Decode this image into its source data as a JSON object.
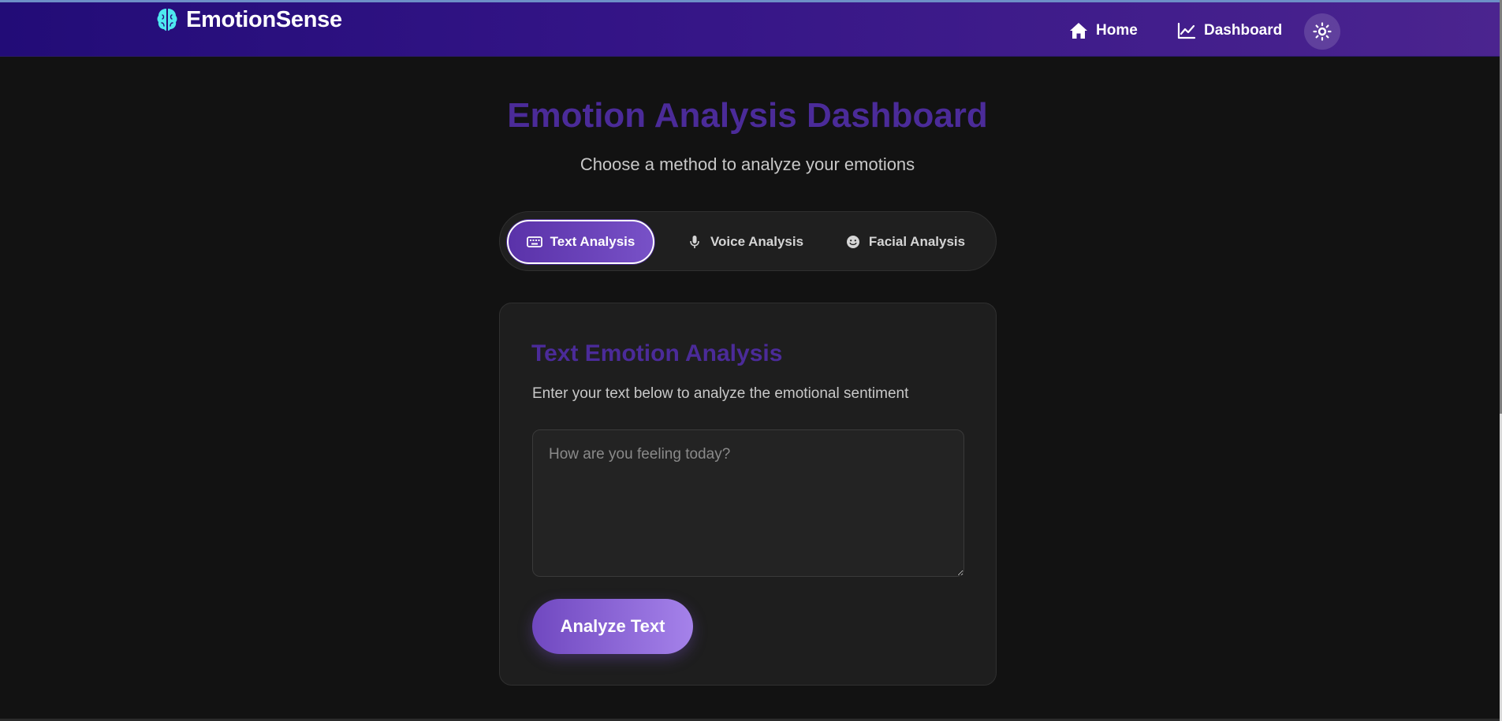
{
  "brand": {
    "name": "EmotionSense",
    "icon": "brain-icon"
  },
  "nav": {
    "items": [
      {
        "label": "Home",
        "icon": "home-icon"
      },
      {
        "label": "Dashboard",
        "icon": "chart-line-icon"
      }
    ],
    "theme_toggle_icon": "sun-icon"
  },
  "page": {
    "title": "Emotion Analysis Dashboard",
    "subtitle": "Choose a method to analyze your emotions"
  },
  "tabs": [
    {
      "label": "Text Analysis",
      "icon": "keyboard-icon",
      "active": true
    },
    {
      "label": "Voice Analysis",
      "icon": "microphone-icon",
      "active": false
    },
    {
      "label": "Facial Analysis",
      "icon": "smile-icon",
      "active": false
    }
  ],
  "card": {
    "title": "Text Emotion Analysis",
    "description": "Enter your text below to analyze the emotional sentiment",
    "input_placeholder": "How are you feeling today?",
    "input_value": "",
    "button_label": "Analyze Text"
  },
  "colors": {
    "header_start": "#220c77",
    "header_end": "#4b248f",
    "accent": "#4b2b99",
    "button_gradient_start": "#7048c0",
    "button_gradient_end": "#a582ea",
    "background": "#121212",
    "brand_icon": "#4ee8f0"
  }
}
